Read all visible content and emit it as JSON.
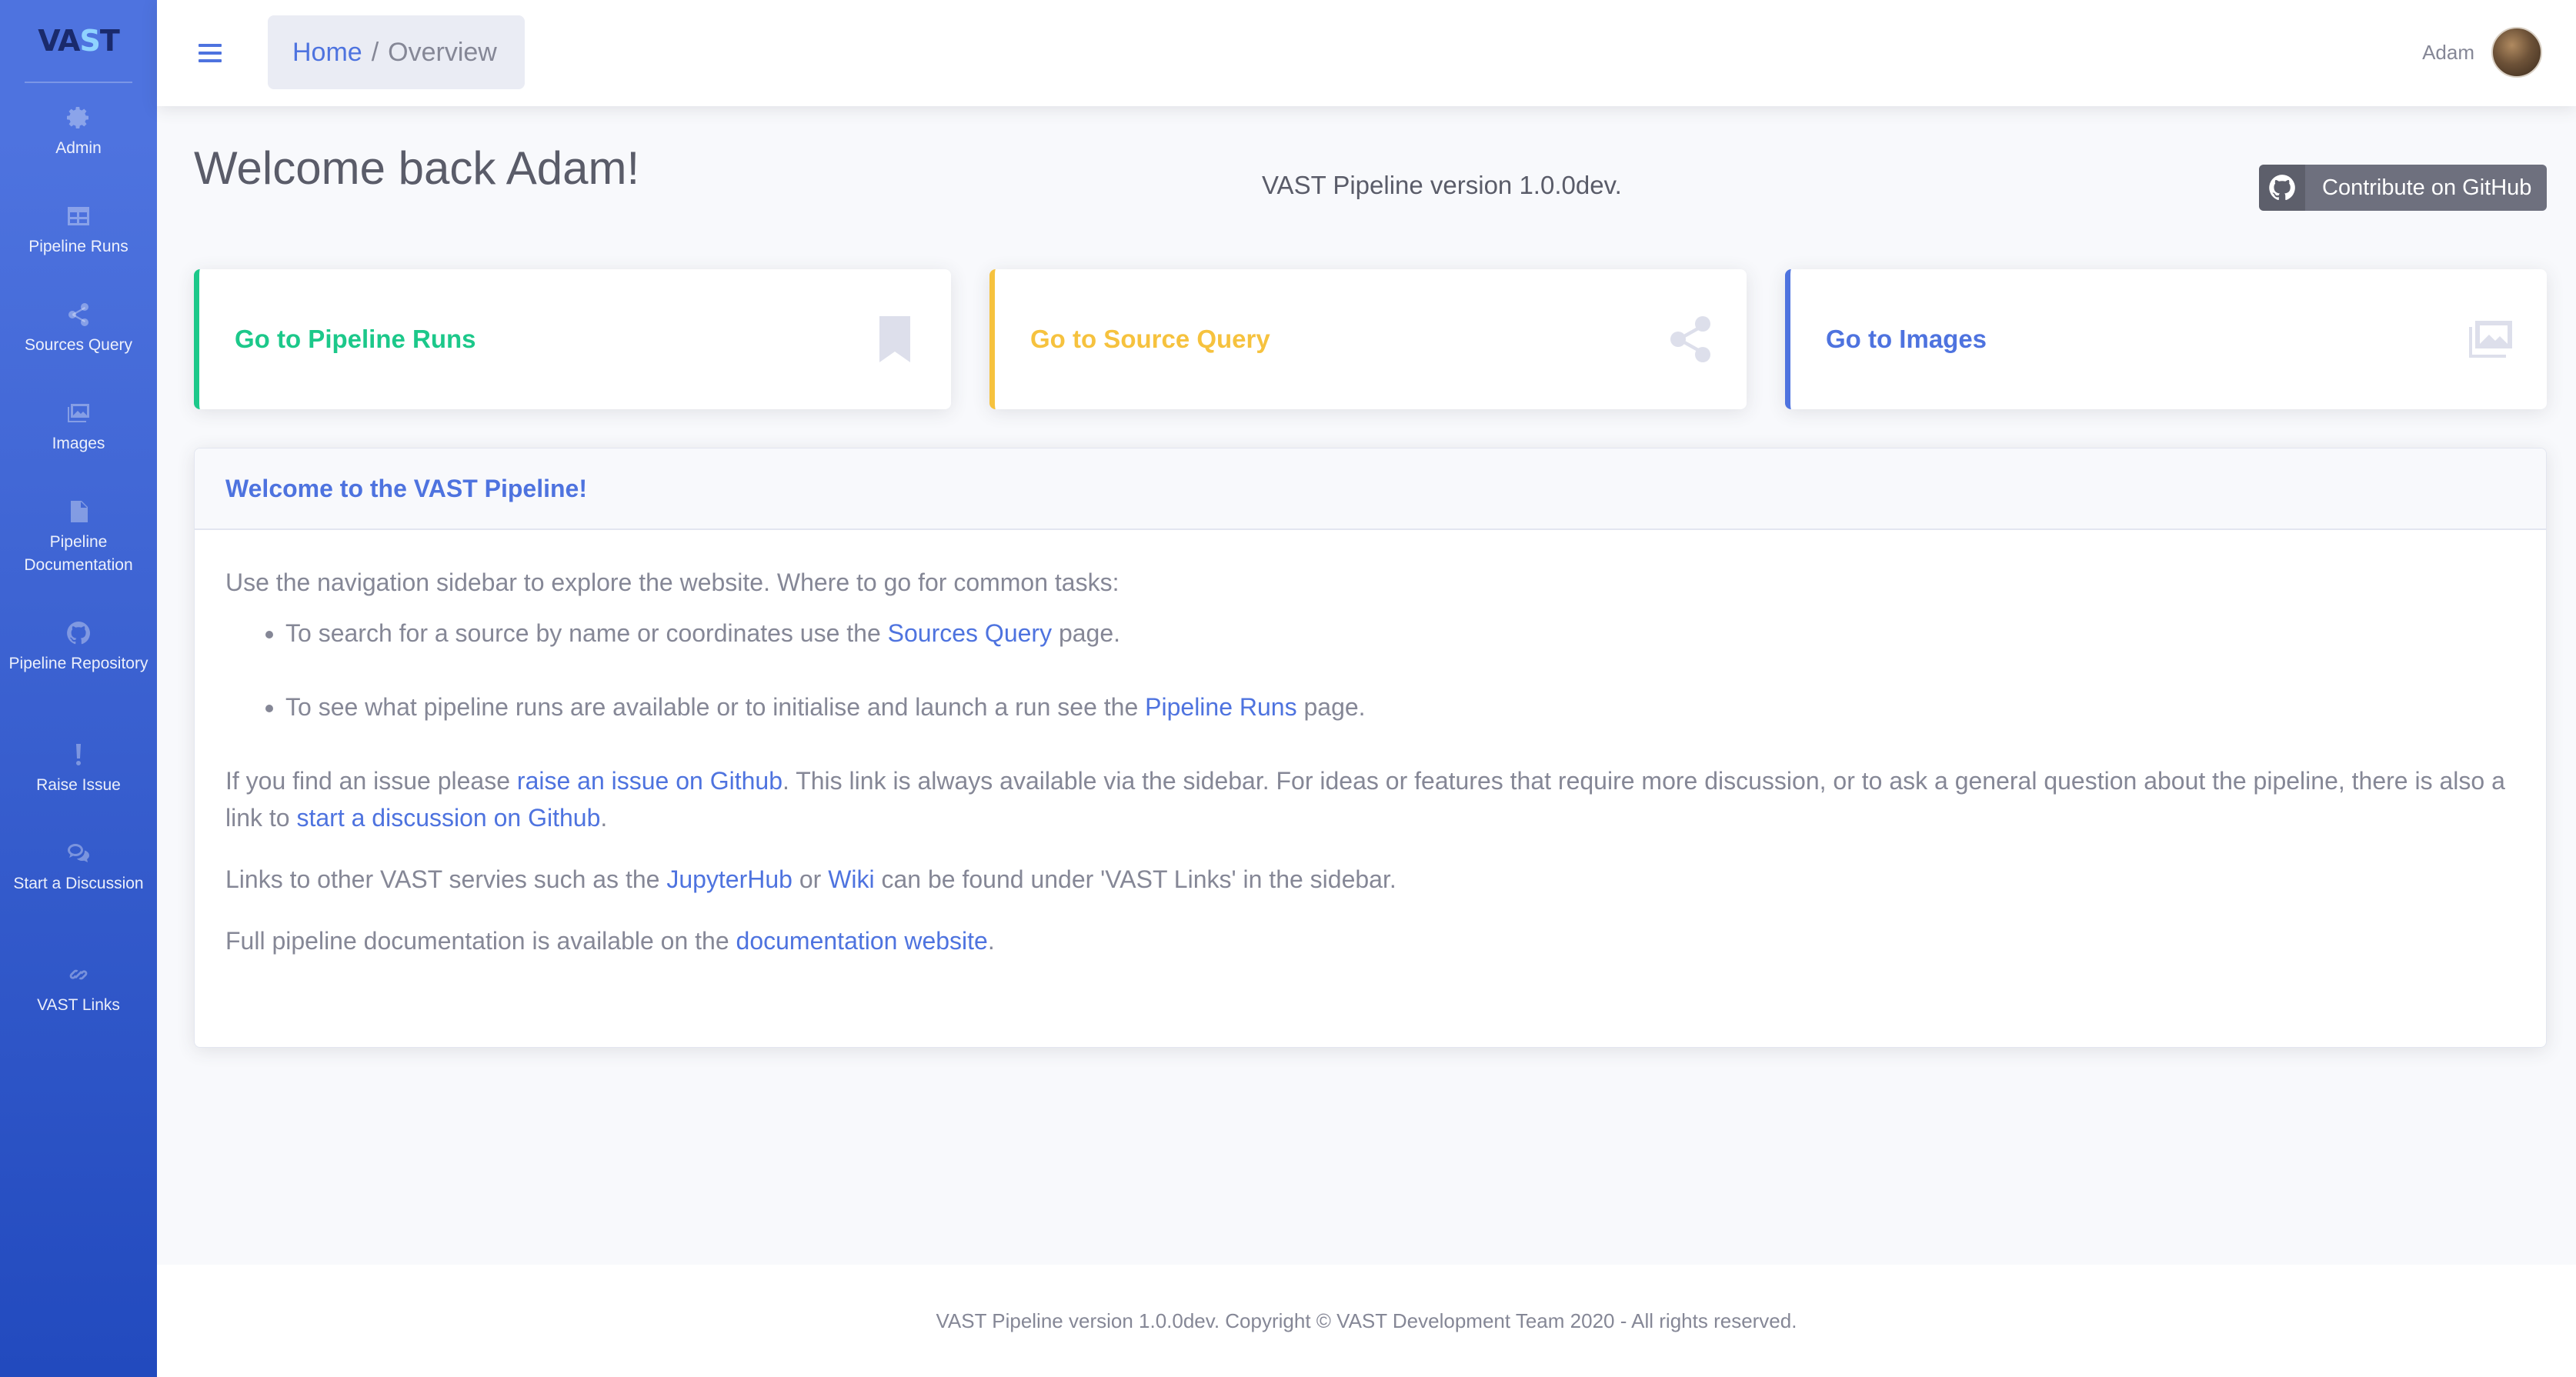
{
  "sidebar": {
    "brand": {
      "logo_text_a": "VA",
      "logo_text_b": "S",
      "logo_text_c": "T"
    },
    "items": [
      {
        "label": "Admin",
        "icon": "gear-icon"
      },
      {
        "label": "Pipeline Runs",
        "icon": "table-icon"
      },
      {
        "label": "Sources Query",
        "icon": "share-icon"
      },
      {
        "label": "Images",
        "icon": "images-icon"
      },
      {
        "label": "Pipeline Documentation",
        "icon": "file-icon"
      },
      {
        "label": "Pipeline Repository",
        "icon": "github-icon"
      },
      {
        "label": "Raise Issue",
        "icon": "exclamation-icon"
      },
      {
        "label": "Start a Discussion",
        "icon": "comments-icon"
      },
      {
        "label": "VAST Links",
        "icon": "link-icon"
      }
    ]
  },
  "topbar": {
    "breadcrumb": {
      "home": "Home",
      "separator": "/",
      "current": "Overview"
    },
    "user_name": "Adam"
  },
  "main": {
    "welcome_title": "Welcome back Adam!",
    "version_text": "VAST Pipeline version 1.0.0dev.",
    "github_button": "Contribute on GitHub",
    "cards": [
      {
        "label": "Go to Pipeline Runs",
        "icon": "bookmark-icon",
        "color": "#1cc88a"
      },
      {
        "label": "Go to Source Query",
        "icon": "share-icon",
        "color": "#f6c23e"
      },
      {
        "label": "Go to Images",
        "icon": "images-icon",
        "color": "#4e73df"
      }
    ],
    "info": {
      "header": "Welcome to the VAST Pipeline!",
      "intro": "Use the navigation sidebar to explore the website. Where to go for common tasks:",
      "bullet1_pre": "To search for a source by name or coordinates use the ",
      "bullet1_link": "Sources Query",
      "bullet1_post": " page.",
      "bullet2_pre": "To see what pipeline runs are available or to initialise and launch a run see the ",
      "bullet2_link": "Pipeline Runs",
      "bullet2_post": " page.",
      "issue_pre": "If you find an issue please ",
      "issue_link": "raise an issue on Github",
      "issue_mid": ". This link is always available via the sidebar. For ideas or features that require more discussion, or to ask a general question about the pipeline, there is also a link to ",
      "discussion_link": "start a discussion on Github",
      "issue_post": ".",
      "links_pre": "Links to other VAST servies such as the ",
      "jupyter_link": "JupyterHub",
      "links_or": " or ",
      "wiki_link": "Wiki",
      "links_post": " can be found under 'VAST Links' in the sidebar.",
      "docs_pre": "Full pipeline documentation is available on the ",
      "docs_link": "documentation website",
      "docs_post": "."
    }
  },
  "footer": {
    "text": "VAST Pipeline version 1.0.0dev. Copyright © VAST Development Team 2020 - All rights reserved."
  },
  "colors": {
    "primary": "#4e73df",
    "success": "#1cc88a",
    "warning": "#f6c23e",
    "text": "#858796"
  }
}
